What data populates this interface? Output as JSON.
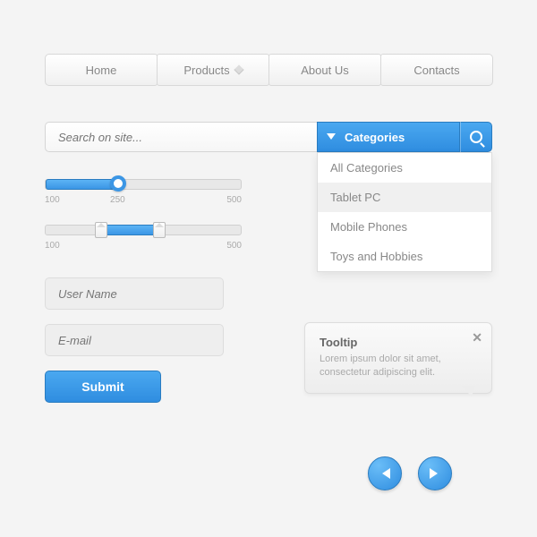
{
  "nav": {
    "items": [
      "Home",
      "Products",
      "About Us",
      "Contacts"
    ]
  },
  "search": {
    "placeholder": "Search on site...",
    "category_label": "Categories",
    "dropdown": [
      "All Categories",
      "Tablet PC",
      "Mobile Phones",
      "Toys and Hobbies"
    ]
  },
  "sliders": {
    "single": {
      "min": "100",
      "mid": "250",
      "max": "500",
      "value_pct": 37
    },
    "range": {
      "min": "100",
      "max": "500",
      "low_pct": 28,
      "high_pct": 58
    }
  },
  "form": {
    "username_placeholder": "User Name",
    "email_placeholder": "E-mail",
    "submit_label": "Submit"
  },
  "tooltip": {
    "title": "Tooltip",
    "body": "Lorem ipsum dolor sit amet, consectetur adipiscing elit."
  },
  "colors": {
    "accent": "#3b96e5"
  }
}
